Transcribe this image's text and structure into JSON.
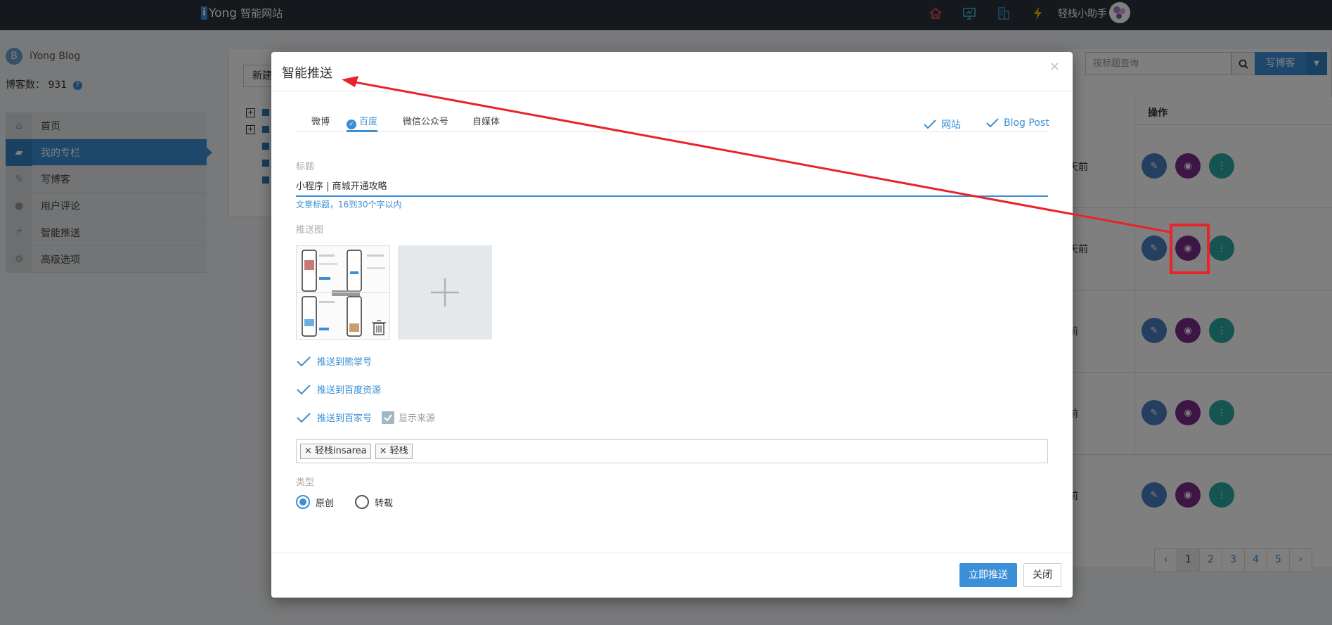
{
  "topbar": {
    "brand_mark": "i",
    "brand_name": "Yong",
    "brand_sub": "智能网站",
    "user_name": "轻栈小助手",
    "icons": [
      "home-icon",
      "monitor-icon",
      "building-icon",
      "lightning-icon"
    ]
  },
  "sidebar": {
    "blog_avatar": "B",
    "blog_name": "iYong Blog",
    "count_label": "博客数：",
    "count_value": "931",
    "help": "?",
    "items": [
      {
        "label": "首页",
        "icon": "home-icon"
      },
      {
        "label": "我的专栏",
        "icon": "folder-open-icon"
      },
      {
        "label": "写博客",
        "icon": "edit-icon"
      },
      {
        "label": "用户评论",
        "icon": "comment-icon"
      },
      {
        "label": "智能推送",
        "icon": "share-icon"
      },
      {
        "label": "高级选项",
        "icon": "cogs-icon"
      }
    ]
  },
  "main": {
    "new_button": "新建",
    "search_placeholder": "按标题查询",
    "write_button": "写博客",
    "ops_header": "操作",
    "rows": [
      {
        "ago": "天前"
      },
      {
        "ago": "天前"
      },
      {
        "ago": "前"
      },
      {
        "ago": "前"
      },
      {
        "ago": "前"
      }
    ],
    "pager": [
      "‹",
      "1",
      "2",
      "3",
      "4",
      "5",
      "›"
    ]
  },
  "modal": {
    "title": "智能推送",
    "close": "×",
    "tabs": [
      "微博",
      "百度",
      "微信公众号",
      "自媒体"
    ],
    "active_tab": "百度",
    "right_options": [
      "网站",
      "Blog Post"
    ],
    "title_label": "标题",
    "title_value": "小程序 | 商城开通攻略",
    "title_hint": "文章标题，16到30个字以内",
    "image_label": "推送图",
    "checks": [
      "推送到熊掌号",
      "推送到百度资源",
      "推送到百家号"
    ],
    "show_source": "显示来源",
    "tags": [
      "× 轻栈insarea",
      "× 轻栈"
    ],
    "type_label": "类型",
    "type_options": [
      "原创",
      "转载"
    ],
    "type_selected": "原创",
    "push_button": "立即推送",
    "close_button": "关闭"
  },
  "colors": {
    "accent": "#3a8fd6",
    "topbar": "#2b3038",
    "annotation": "#e8232a",
    "op_edit": "#4a7ec0",
    "op_rss": "#7b2d8b",
    "op_more": "#2ba8a0"
  }
}
